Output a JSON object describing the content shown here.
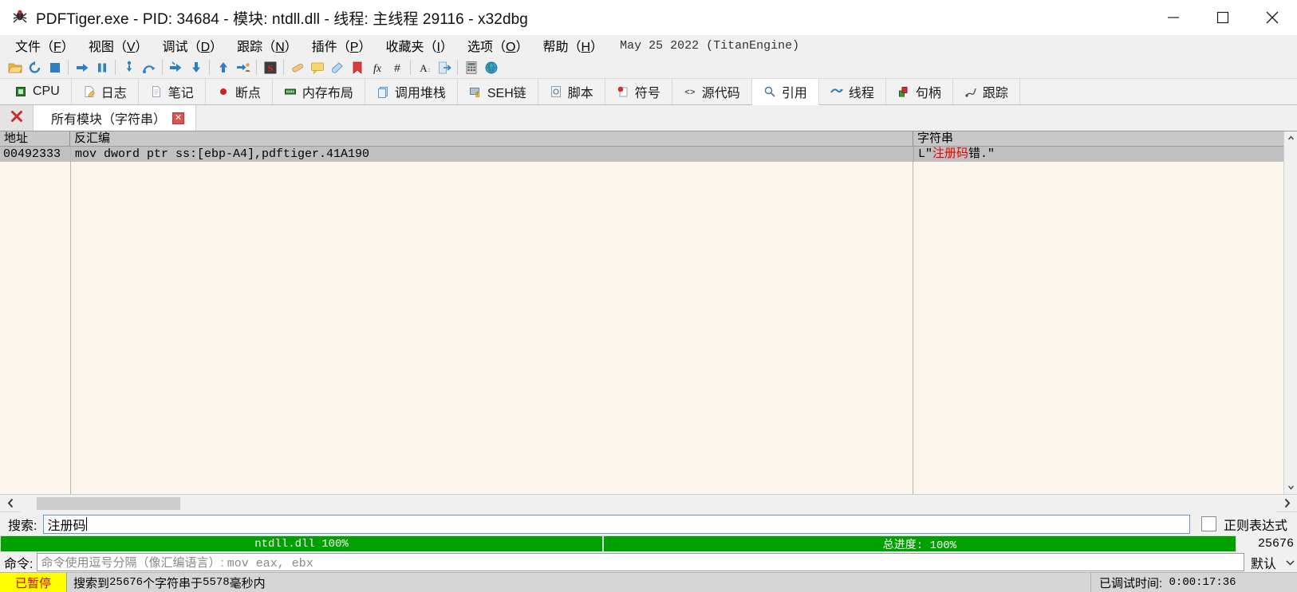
{
  "window": {
    "title": "PDFTiger.exe - PID: 34684 - 模块: ntdll.dll - 线程: 主线程 29116 - x32dbg",
    "icon": "bug-icon",
    "minimize_label": "最小化",
    "maximize_label": "最大化",
    "close_label": "关闭"
  },
  "menubar": {
    "items": [
      {
        "label": "文件(F)",
        "text": "文件",
        "accel": "F"
      },
      {
        "label": "视图(V)",
        "text": "视图",
        "accel": "V"
      },
      {
        "label": "调试(D)",
        "text": "调试",
        "accel": "D"
      },
      {
        "label": "跟踪(N)",
        "text": "跟踪",
        "accel": "N"
      },
      {
        "label": "插件(P)",
        "text": "插件",
        "accel": "P"
      },
      {
        "label": "收藏夹(I)",
        "text": "收藏夹",
        "accel": "I"
      },
      {
        "label": "选项(O)",
        "text": "选项",
        "accel": "O"
      },
      {
        "label": "帮助(H)",
        "text": "帮助",
        "accel": "H"
      }
    ],
    "version": "May 25 2022 (TitanEngine)"
  },
  "toolbar": {
    "buttons": [
      {
        "name": "open-folder-icon"
      },
      {
        "name": "restart-icon"
      },
      {
        "name": "stop-icon"
      },
      {
        "name": "separator"
      },
      {
        "name": "run-icon"
      },
      {
        "name": "pause-icon"
      },
      {
        "name": "separator"
      },
      {
        "name": "step-into-icon"
      },
      {
        "name": "step-over-icon"
      },
      {
        "name": "separator"
      },
      {
        "name": "step-into-arrow-icon"
      },
      {
        "name": "step-down-icon"
      },
      {
        "name": "separator"
      },
      {
        "name": "execute-till-return-icon"
      },
      {
        "name": "run-to-user-code-icon"
      },
      {
        "name": "separator"
      },
      {
        "name": "scylla-icon"
      },
      {
        "name": "separator"
      },
      {
        "name": "patch-icon"
      },
      {
        "name": "comment-icon"
      },
      {
        "name": "label-icon"
      },
      {
        "name": "bookmark-icon"
      },
      {
        "name": "function-icon"
      },
      {
        "name": "hash-icon"
      },
      {
        "name": "separator"
      },
      {
        "name": "font-icon"
      },
      {
        "name": "attach-icon"
      },
      {
        "name": "separator"
      },
      {
        "name": "calculator-icon"
      },
      {
        "name": "globe-icon"
      }
    ]
  },
  "tabs": {
    "items": [
      {
        "label": "CPU",
        "icon": "cpu-icon",
        "active": false
      },
      {
        "label": "日志",
        "icon": "log-icon",
        "active": false
      },
      {
        "label": "笔记",
        "icon": "notes-icon",
        "active": false
      },
      {
        "label": "断点",
        "icon": "breakpoint-icon",
        "active": false
      },
      {
        "label": "内存布局",
        "icon": "memory-map-icon",
        "active": false
      },
      {
        "label": "调用堆栈",
        "icon": "call-stack-icon",
        "active": false
      },
      {
        "label": "SEH链",
        "icon": "seh-icon",
        "active": false
      },
      {
        "label": "脚本",
        "icon": "script-icon",
        "active": false
      },
      {
        "label": "符号",
        "icon": "symbols-icon",
        "active": false
      },
      {
        "label": "源代码",
        "icon": "source-icon",
        "active": false
      },
      {
        "label": "引用",
        "icon": "references-icon",
        "active": true
      },
      {
        "label": "线程",
        "icon": "threads-icon",
        "active": false
      },
      {
        "label": "句柄",
        "icon": "handles-icon",
        "active": false
      },
      {
        "label": "跟踪",
        "icon": "trace-icon",
        "active": false
      }
    ]
  },
  "subtabs": {
    "close_all_icon": "close-all-icon",
    "items": [
      {
        "label": "所有模块（字符串）",
        "close_icon": "close-icon",
        "active": true
      }
    ]
  },
  "table": {
    "columns": [
      {
        "key": "address",
        "label": "地址"
      },
      {
        "key": "disassembly",
        "label": "反汇编"
      },
      {
        "key": "string",
        "label": "字符串"
      }
    ],
    "rows": [
      {
        "address": "00492333",
        "disassembly": "mov dword ptr ss:[ebp-A4],pdftiger.41A190",
        "string_prefix": "L\"",
        "string_match": "注册码",
        "string_suffix": "错.\"",
        "selected": true
      }
    ]
  },
  "search": {
    "label": "搜索:",
    "value": "注册码",
    "placeholder": "",
    "regex_label": "正则表达式",
    "regex_checked": false
  },
  "progress": {
    "module_bar": {
      "text": "ntdll.dll 100%",
      "percent": 100
    },
    "total_bar": {
      "text": "总进度: 100%",
      "percent": 100
    },
    "count": "25676"
  },
  "command": {
    "label": "命令:",
    "placeholder": "命令使用逗号分隔（像汇编语言）: mov eax, ebx",
    "placeholder_cjk": "命令使用逗号分隔（像汇编语言）:",
    "placeholder_mono": "mov eax, ebx",
    "mode": "默认",
    "value": ""
  },
  "statusbar": {
    "state": "已暂停",
    "message_prefix": "搜索到",
    "message_count": "25676",
    "message_middle": "个字符串于",
    "message_ms": "5578",
    "message_suffix": "毫秒内",
    "time_label": "已调试时间:",
    "time_value": "0:00:17:36"
  },
  "colors": {
    "accent_green": "#00a000",
    "status_yellow": "#ffff00",
    "status_red": "#d00000",
    "match_red": "#e60000",
    "selection_gray": "#c0c0c0",
    "table_bg": "#fdf6ee",
    "header_gray": "#c8c8c8"
  }
}
